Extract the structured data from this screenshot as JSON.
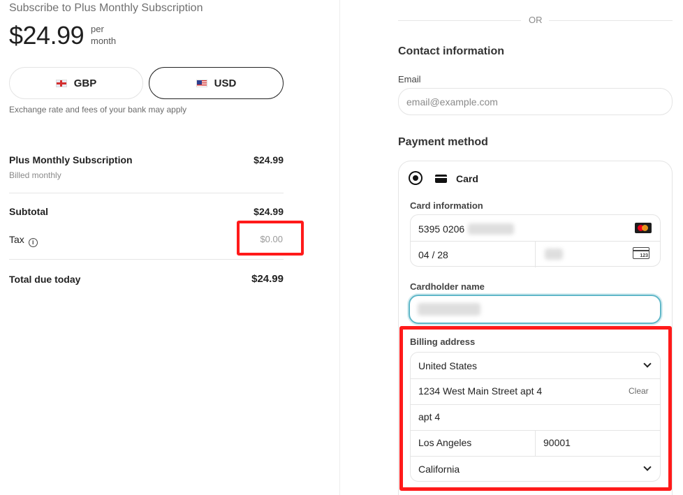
{
  "summary": {
    "title": "Subscribe to Plus Monthly Subscription",
    "price": "$24.99",
    "period_line1": "per",
    "period_line2": "month",
    "currencies": [
      {
        "code": "GBP",
        "flag": "uk-flag",
        "selected": false
      },
      {
        "code": "USD",
        "flag": "us-flag",
        "selected": true
      }
    ],
    "fx_note": "Exchange rate and fees of your bank may apply",
    "line_item": {
      "name": "Plus Monthly Subscription",
      "sub": "Billed monthly",
      "amount": "$24.99"
    },
    "subtotal": {
      "label": "Subtotal",
      "amount": "$24.99"
    },
    "tax": {
      "label": "Tax",
      "amount": "$0.00"
    },
    "total": {
      "label": "Total due today",
      "amount": "$24.99"
    }
  },
  "checkout": {
    "or_label": "OR",
    "contact_title": "Contact information",
    "email_label": "Email",
    "email_placeholder": "email@example.com",
    "payment_title": "Payment method",
    "card_option": "Card",
    "card_info_label": "Card information",
    "card_number_prefix": "5395 0206",
    "card_expiry": "04 / 28",
    "cardholder_label": "Cardholder name",
    "billing_label": "Billing address",
    "country": "United States",
    "address_line1": "1234 West Main Street apt 4",
    "clear_label": "Clear",
    "address_line2": "apt 4",
    "city": "Los Angeles",
    "zip": "90001",
    "state": "California"
  },
  "colors": {
    "highlight": "#ff1a1a",
    "focus_ring": "#5fb7c8"
  }
}
